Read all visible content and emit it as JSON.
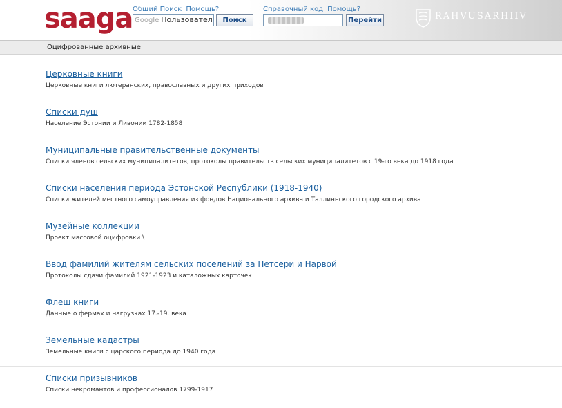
{
  "header": {
    "logo_text": "saaga",
    "general_search_label": "Общий Поиск",
    "help_label_1": "Помощь?",
    "search_input_brand": "Google",
    "search_input_value": "Пользователь",
    "search_button_label": "Поиск",
    "reference_code_label": "Справочный код",
    "help_label_2": "Помощь?",
    "go_button_label": "Перейти",
    "archive_name": "RAHVUSARHIIV"
  },
  "subbar": {
    "title": "Оцифрованные архивные"
  },
  "items": [
    {
      "title": "Церковные книги",
      "desc": "Церковные книги лютеранских, православных и других приходов"
    },
    {
      "title": "Списки душ",
      "desc": "Население Эстонии и Ливонии 1782-1858"
    },
    {
      "title": "Муниципальные правительственные документы",
      "desc": "Списки членов сельских муниципалитетов, протоколы правительств сельских муниципалитетов с 19-го века до 1918 года"
    },
    {
      "title": "Списки населения периода Эстонской Республики (1918-1940)",
      "desc": "Списки жителей местного самоуправления из фондов Национального архива и Таллиннского городского архива"
    },
    {
      "title": "Музейные коллекции",
      "desc": "Проект массовой оцифровки \\"
    },
    {
      "title": "Ввод фамилий жителям сельских поселений за Петсери и Нарвой",
      "desc": "Протоколы сдачи фамилий 1921-1923 и каталожных карточек"
    },
    {
      "title": "Флеш книги",
      "desc": "Данные о фермах и нагрузках 17.-19. века"
    },
    {
      "title": "Земельные кадастры",
      "desc": "Земельные книги с царского периода до 1940 года"
    },
    {
      "title": "Списки призывников",
      "desc": "Списки некромантов и профессионалов 1799-1917"
    }
  ],
  "colors": {
    "logo": "#b41f30",
    "link": "#1a5f9e",
    "button_text": "#1f4e88"
  }
}
